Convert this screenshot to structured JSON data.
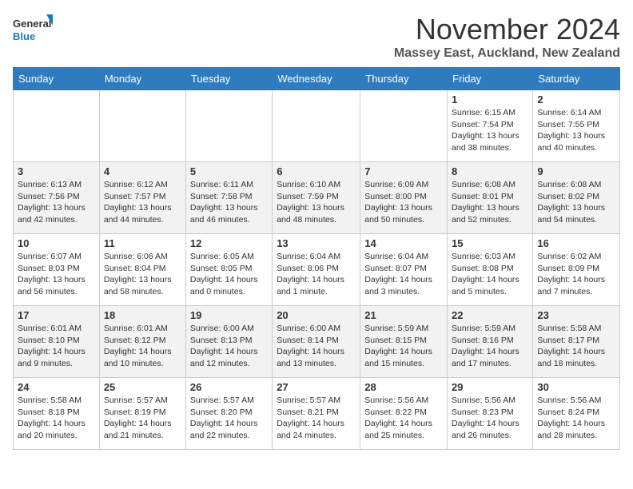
{
  "logo": {
    "line1": "General",
    "line2": "Blue"
  },
  "title": "November 2024",
  "location": "Massey East, Auckland, New Zealand",
  "weekdays": [
    "Sunday",
    "Monday",
    "Tuesday",
    "Wednesday",
    "Thursday",
    "Friday",
    "Saturday"
  ],
  "weeks": [
    [
      {
        "day": "",
        "info": ""
      },
      {
        "day": "",
        "info": ""
      },
      {
        "day": "",
        "info": ""
      },
      {
        "day": "",
        "info": ""
      },
      {
        "day": "",
        "info": ""
      },
      {
        "day": "1",
        "info": "Sunrise: 6:15 AM\nSunset: 7:54 PM\nDaylight: 13 hours and 38 minutes."
      },
      {
        "day": "2",
        "info": "Sunrise: 6:14 AM\nSunset: 7:55 PM\nDaylight: 13 hours and 40 minutes."
      }
    ],
    [
      {
        "day": "3",
        "info": "Sunrise: 6:13 AM\nSunset: 7:56 PM\nDaylight: 13 hours and 42 minutes."
      },
      {
        "day": "4",
        "info": "Sunrise: 6:12 AM\nSunset: 7:57 PM\nDaylight: 13 hours and 44 minutes."
      },
      {
        "day": "5",
        "info": "Sunrise: 6:11 AM\nSunset: 7:58 PM\nDaylight: 13 hours and 46 minutes."
      },
      {
        "day": "6",
        "info": "Sunrise: 6:10 AM\nSunset: 7:59 PM\nDaylight: 13 hours and 48 minutes."
      },
      {
        "day": "7",
        "info": "Sunrise: 6:09 AM\nSunset: 8:00 PM\nDaylight: 13 hours and 50 minutes."
      },
      {
        "day": "8",
        "info": "Sunrise: 6:08 AM\nSunset: 8:01 PM\nDaylight: 13 hours and 52 minutes."
      },
      {
        "day": "9",
        "info": "Sunrise: 6:08 AM\nSunset: 8:02 PM\nDaylight: 13 hours and 54 minutes."
      }
    ],
    [
      {
        "day": "10",
        "info": "Sunrise: 6:07 AM\nSunset: 8:03 PM\nDaylight: 13 hours and 56 minutes."
      },
      {
        "day": "11",
        "info": "Sunrise: 6:06 AM\nSunset: 8:04 PM\nDaylight: 13 hours and 58 minutes."
      },
      {
        "day": "12",
        "info": "Sunrise: 6:05 AM\nSunset: 8:05 PM\nDaylight: 14 hours and 0 minutes."
      },
      {
        "day": "13",
        "info": "Sunrise: 6:04 AM\nSunset: 8:06 PM\nDaylight: 14 hours and 1 minute."
      },
      {
        "day": "14",
        "info": "Sunrise: 6:04 AM\nSunset: 8:07 PM\nDaylight: 14 hours and 3 minutes."
      },
      {
        "day": "15",
        "info": "Sunrise: 6:03 AM\nSunset: 8:08 PM\nDaylight: 14 hours and 5 minutes."
      },
      {
        "day": "16",
        "info": "Sunrise: 6:02 AM\nSunset: 8:09 PM\nDaylight: 14 hours and 7 minutes."
      }
    ],
    [
      {
        "day": "17",
        "info": "Sunrise: 6:01 AM\nSunset: 8:10 PM\nDaylight: 14 hours and 9 minutes."
      },
      {
        "day": "18",
        "info": "Sunrise: 6:01 AM\nSunset: 8:12 PM\nDaylight: 14 hours and 10 minutes."
      },
      {
        "day": "19",
        "info": "Sunrise: 6:00 AM\nSunset: 8:13 PM\nDaylight: 14 hours and 12 minutes."
      },
      {
        "day": "20",
        "info": "Sunrise: 6:00 AM\nSunset: 8:14 PM\nDaylight: 14 hours and 13 minutes."
      },
      {
        "day": "21",
        "info": "Sunrise: 5:59 AM\nSunset: 8:15 PM\nDaylight: 14 hours and 15 minutes."
      },
      {
        "day": "22",
        "info": "Sunrise: 5:59 AM\nSunset: 8:16 PM\nDaylight: 14 hours and 17 minutes."
      },
      {
        "day": "23",
        "info": "Sunrise: 5:58 AM\nSunset: 8:17 PM\nDaylight: 14 hours and 18 minutes."
      }
    ],
    [
      {
        "day": "24",
        "info": "Sunrise: 5:58 AM\nSunset: 8:18 PM\nDaylight: 14 hours and 20 minutes."
      },
      {
        "day": "25",
        "info": "Sunrise: 5:57 AM\nSunset: 8:19 PM\nDaylight: 14 hours and 21 minutes."
      },
      {
        "day": "26",
        "info": "Sunrise: 5:57 AM\nSunset: 8:20 PM\nDaylight: 14 hours and 22 minutes."
      },
      {
        "day": "27",
        "info": "Sunrise: 5:57 AM\nSunset: 8:21 PM\nDaylight: 14 hours and 24 minutes."
      },
      {
        "day": "28",
        "info": "Sunrise: 5:56 AM\nSunset: 8:22 PM\nDaylight: 14 hours and 25 minutes."
      },
      {
        "day": "29",
        "info": "Sunrise: 5:56 AM\nSunset: 8:23 PM\nDaylight: 14 hours and 26 minutes."
      },
      {
        "day": "30",
        "info": "Sunrise: 5:56 AM\nSunset: 8:24 PM\nDaylight: 14 hours and 28 minutes."
      }
    ]
  ]
}
